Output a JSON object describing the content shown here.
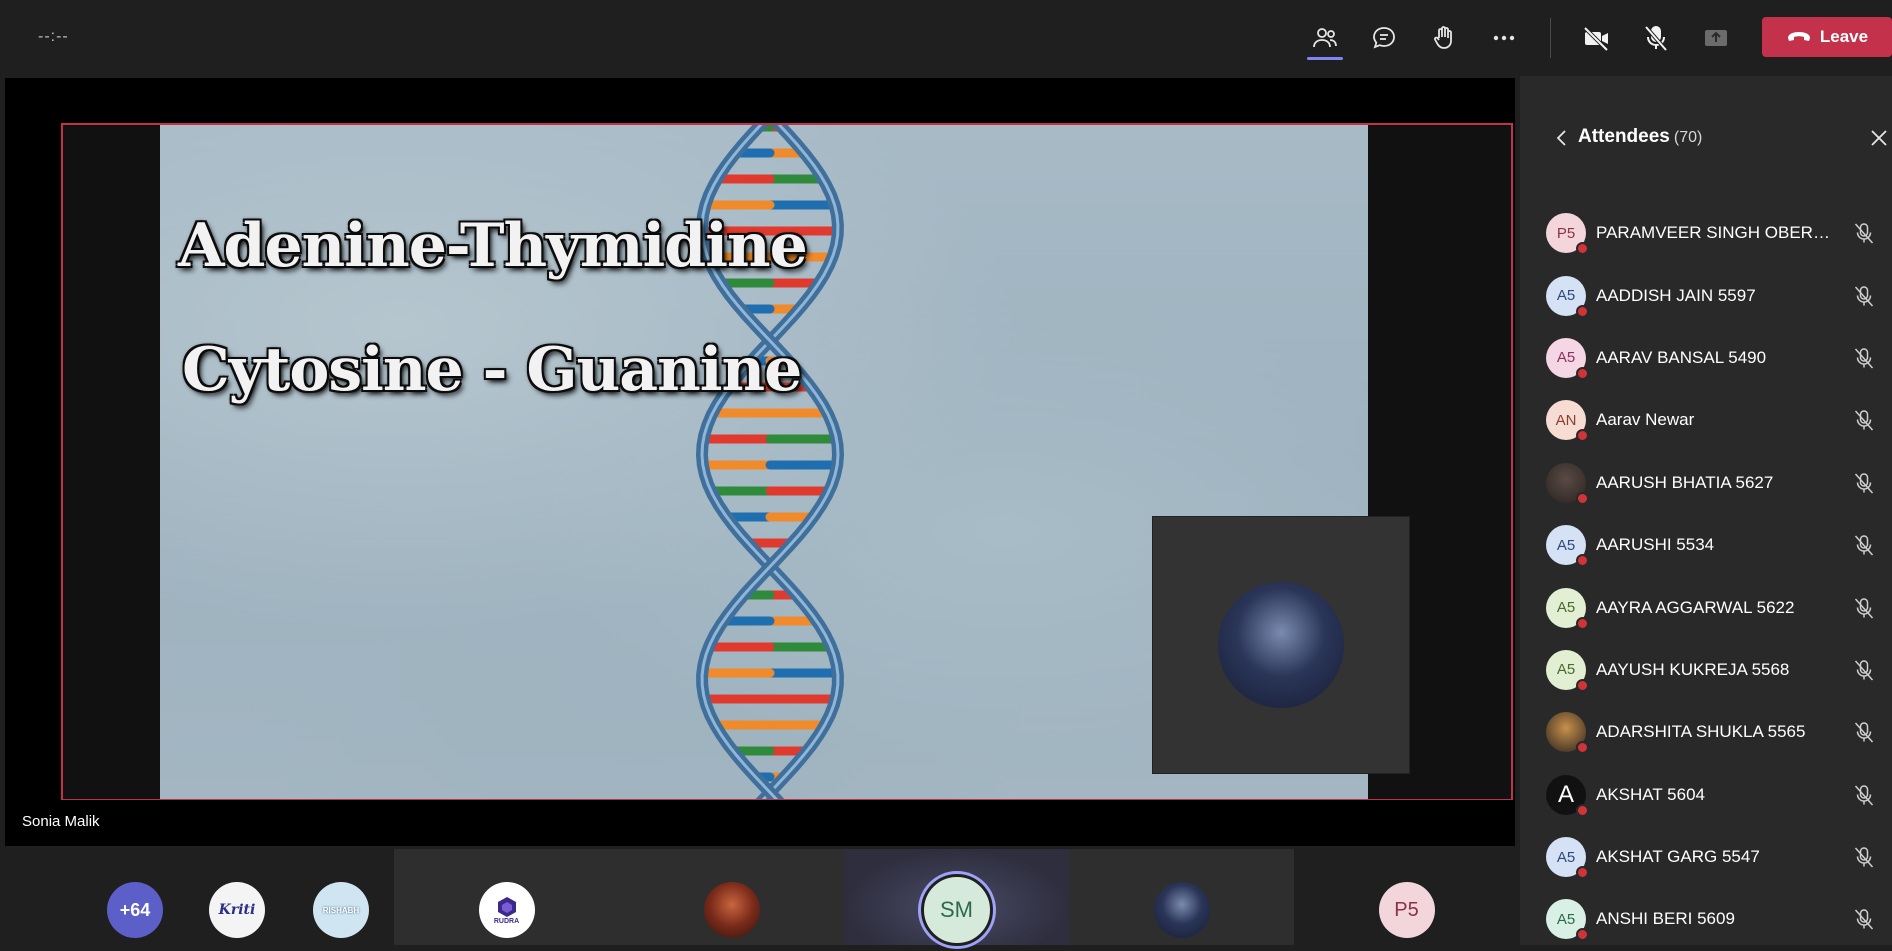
{
  "topbar": {
    "timer": "--:--",
    "leave_label": "Leave"
  },
  "slide": {
    "line1": "Adenine-Thymidine",
    "line2": "Cytosine - Guanine"
  },
  "presenter_name": "Sonia Malik",
  "gallery": [
    {
      "type": "overflow",
      "label": "+64",
      "bg": "#5b5fc7"
    },
    {
      "type": "logo",
      "label": "Kriti",
      "bg": "#f4f4f4"
    },
    {
      "type": "logo",
      "label": "RISHABH",
      "bg": "#cfe6f2"
    },
    {
      "type": "logo",
      "label": "RUDRA",
      "bg": "#ffffff"
    },
    {
      "type": "photo",
      "label": "",
      "bg": "#6b2a1c"
    },
    {
      "type": "initials",
      "label": "SM",
      "bg": "#d6eadc",
      "active": true
    },
    {
      "type": "photo",
      "label": "",
      "bg": "#2a3558"
    },
    {
      "type": "initials",
      "label": "P5",
      "bg": "#f3d6dc"
    }
  ],
  "sidebar": {
    "title": "Attendees",
    "count": "(70)",
    "attendees": [
      {
        "initials": "P5",
        "name": "PARAMVEER SINGH OBEROY ...",
        "bg": "#f3d6dc",
        "fg": "#8a3344"
      },
      {
        "initials": "A5",
        "name": "AADDISH JAIN 5597",
        "bg": "#d5e2f5",
        "fg": "#2c4a7a"
      },
      {
        "initials": "A5",
        "name": "AARAV BANSAL 5490",
        "bg": "#f5d6e4",
        "fg": "#8a3360"
      },
      {
        "initials": "AN",
        "name": "Aarav Newar",
        "bg": "#f7dcd3",
        "fg": "#8a4030"
      },
      {
        "initials": "",
        "name": "AARUSH BHATIA 5627",
        "bg": "#5a4a44",
        "fg": "#fff",
        "photo": true
      },
      {
        "initials": "A5",
        "name": "AARUSHI 5534",
        "bg": "#d5e2f5",
        "fg": "#2c4a7a"
      },
      {
        "initials": "A5",
        "name": "AAYRA AGGARWAL 5622",
        "bg": "#e2efd3",
        "fg": "#4a6a2c"
      },
      {
        "initials": "A5",
        "name": "AAYUSH KUKREJA 5568",
        "bg": "#e2efd3",
        "fg": "#4a6a2c"
      },
      {
        "initials": "",
        "name": "ADARSHITA SHUKLA 5565",
        "bg": "#c8904a",
        "fg": "#fff",
        "photo": true
      },
      {
        "initials": "A",
        "name": "AKSHAT 5604",
        "bg": "#111111",
        "fg": "#fff"
      },
      {
        "initials": "A5",
        "name": "AKSHAT GARG 5547",
        "bg": "#d5e2f5",
        "fg": "#2c4a7a"
      },
      {
        "initials": "A5",
        "name": "ANSHI BERI 5609",
        "bg": "#d9f0e6",
        "fg": "#2c6a4a"
      }
    ]
  },
  "colors": {
    "accent": "#7f85f5",
    "leave": "#c4314b",
    "status_dot": "#d13438"
  }
}
